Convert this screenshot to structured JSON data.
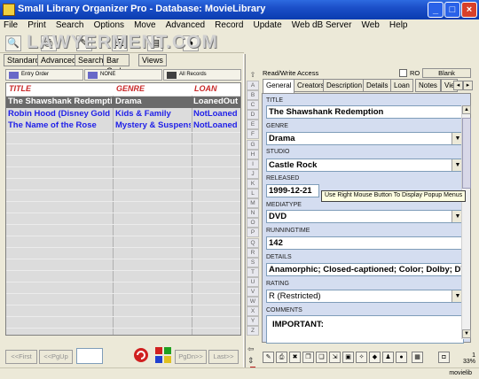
{
  "window": {
    "title": "Small Library Organizer Pro - Database: MovieLibrary",
    "minimize_icon": "minimize-icon",
    "maximize_icon": "maximize-icon",
    "close_icon": "close-icon"
  },
  "menu": [
    "File",
    "Print",
    "Search",
    "Options",
    "Move",
    "Advanced",
    "Record",
    "Update",
    "Web dB Server",
    "Web",
    "Help"
  ],
  "watermark": "LAWYERMENT.COM",
  "mode_tabs": [
    "Standard",
    "Advanced",
    "Search",
    "Bar Code",
    "Views"
  ],
  "filters": {
    "entry_order": "Entry Order",
    "none": "NONE",
    "all_records": "All Records"
  },
  "grid": {
    "headers": [
      "TITLE",
      "GENRE",
      "LOAN"
    ],
    "rows": [
      {
        "title": "The Shawshank Redemption",
        "genre": "Drama",
        "loan": "LoanedOut",
        "selected": true
      },
      {
        "title": "Robin Hood (Disney Gold C",
        "genre": "Kids & Family",
        "loan": "NotLoaned",
        "selected": false
      },
      {
        "title": "The Name of the Rose",
        "genre": "Mystery & Suspense",
        "loan": "NotLoaned",
        "selected": false
      }
    ]
  },
  "nav": {
    "first": "<<First",
    "pgup": "<<PgUp",
    "pgdn": "PgDn>>",
    "last": "Last>>"
  },
  "alphabet": [
    "A",
    "B",
    "C",
    "D",
    "E",
    "F",
    "G",
    "H",
    "I",
    "J",
    "K",
    "L",
    "M",
    "N",
    "O",
    "P",
    "Q",
    "R",
    "S",
    "T",
    "U",
    "V",
    "W",
    "X",
    "Y",
    "Z"
  ],
  "access": {
    "label": "Read/Write Access",
    "ro_label": "RO",
    "blank_button": "Blank"
  },
  "detail_tabs": [
    "General",
    "Creators",
    "Description",
    "Details",
    "Loan",
    "Notes",
    "Vie"
  ],
  "fields": {
    "title": {
      "label": "TITLE",
      "value": "The Shawshank Redemption"
    },
    "genre": {
      "label": "GENRE",
      "value": "Drama"
    },
    "studio": {
      "label": "STUDIO",
      "value": "Castle Rock"
    },
    "released": {
      "label": "RELEASED",
      "value": "1999-12-21"
    },
    "mediatype": {
      "label": "MEDIATYPE",
      "value": "DVD"
    },
    "runningtime": {
      "label": "RUNNINGTIME",
      "value": "142"
    },
    "details": {
      "label": "DETAILS",
      "value": "Anamorphic; Closed-captioned; Color; Dolby; DVD-"
    },
    "rating": {
      "label": "RATING",
      "value": "R (Restricted)"
    },
    "comments": {
      "label": "COMMENTS",
      "value": "IMPORTANT:"
    }
  },
  "tooltip": "Use Right Mouse Button To Display Popup Menus",
  "status": {
    "record": "1",
    "percent": "33%",
    "db": "movielib"
  }
}
